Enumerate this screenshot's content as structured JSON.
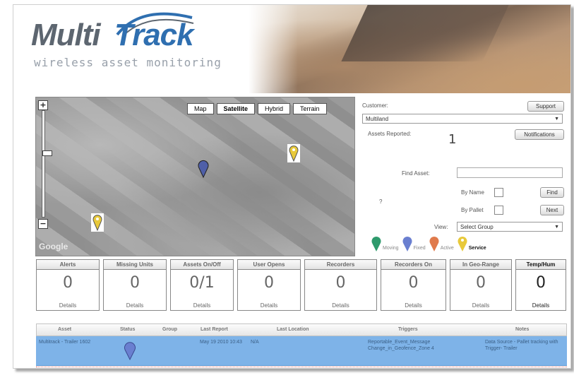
{
  "header": {
    "logo_word1": "Multi",
    "logo_word2": "Track",
    "tagline": "wireless asset monitoring"
  },
  "map": {
    "tabs": [
      {
        "label": "Map"
      },
      {
        "label": "Satellite"
      },
      {
        "label": "Hybrid"
      },
      {
        "label": "Terrain"
      }
    ],
    "active_tab": "Satellite",
    "zoom_in": "+",
    "zoom_out": "−",
    "attribution": "Google"
  },
  "panel": {
    "customer_label": "Customer:",
    "support_button": "Support",
    "customer_value": "Multiland",
    "assets_reported_label": "Assets Reported:",
    "assets_reported_value": "1",
    "notifications_button": "Notifications",
    "find_asset_label": "Find Asset:",
    "find_asset_value": "",
    "by_name_label": "By Name",
    "by_pallet_label": "By Pallet",
    "find_button": "Find",
    "next_button": "Next",
    "side_marker": "?",
    "view_label": "View:",
    "group_select": "Select Group"
  },
  "legend": [
    {
      "label": "Moving",
      "color": "#2e9a6c"
    },
    {
      "label": "Fixed",
      "color": "#6a7fd0"
    },
    {
      "label": "Active",
      "color": "#e07a4c"
    },
    {
      "label": "Service",
      "color": "#e8c93a"
    }
  ],
  "stats": [
    {
      "title": "Alerts",
      "value": "0",
      "link": "Details"
    },
    {
      "title": "Missing Units",
      "value": "0",
      "link": "Details"
    },
    {
      "title": "Assets On/Off",
      "value": "0/1",
      "link": "Details"
    },
    {
      "title": "User Opens",
      "value": "0",
      "link": "Details"
    },
    {
      "title": "Recorders",
      "value": "0",
      "link": "Details"
    },
    {
      "title": "Recorders On",
      "value": "0",
      "link": "Details"
    },
    {
      "title": "In Geo-Range",
      "value": "0",
      "link": "Details"
    },
    {
      "title": "Temp/Hum",
      "value": "0",
      "link": "Details"
    }
  ],
  "table": {
    "columns": [
      "Asset",
      "Status",
      "Group",
      "Last Report",
      "Last Location",
      "Triggers",
      "Notes"
    ],
    "rows": [
      {
        "asset": "Multitrack - Trailer 1602",
        "status_color": "#6a7fd0",
        "group": "",
        "last_report": "May 19 2010 10:43",
        "last_location": "N/A",
        "triggers": "Reportable_Event_Message Change_in_Geofence_Zone 4",
        "notes": "Data Source - Pallet tracking with Trigger- Trailer"
      }
    ]
  },
  "colors": {
    "brand_blue": "#2f6fb0",
    "brand_gray": "#5d6670",
    "row_highlight": "#7eb3e8"
  }
}
